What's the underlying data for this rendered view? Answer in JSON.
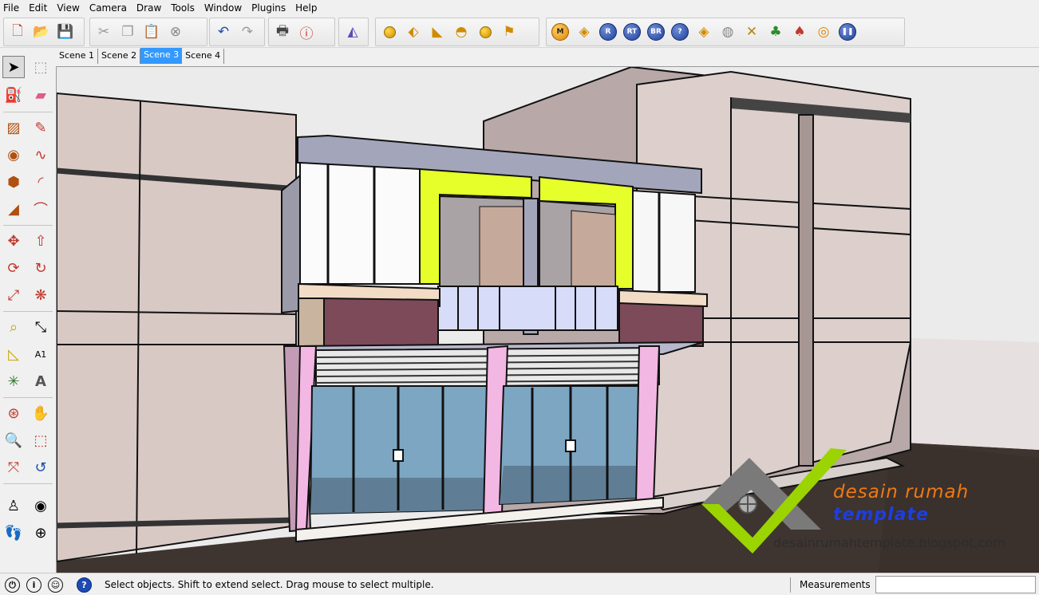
{
  "menu": [
    "File",
    "Edit",
    "View",
    "Camera",
    "Draw",
    "Tools",
    "Window",
    "Plugins",
    "Help"
  ],
  "scenes": [
    {
      "label": "Scene 1",
      "active": false
    },
    {
      "label": "Scene 2",
      "active": false
    },
    {
      "label": "Scene 3",
      "active": true
    },
    {
      "label": "Scene 4",
      "active": false
    }
  ],
  "toolbar": {
    "round_buttons": [
      "M",
      "R",
      "RT",
      "BR",
      "?"
    ]
  },
  "status": {
    "message": "Select objects. Shift to extend select. Drag mouse to select multiple.",
    "measurements_label": "Measurements",
    "measurements_value": ""
  },
  "watermark": {
    "title": "desain rumah",
    "subtitle": "template",
    "url": "desainrumahtemplate.blogspot.com"
  },
  "colors": {
    "selection": "#3399ff",
    "wall": "#ddd0c8",
    "accent_lime": "#e6ff2a",
    "balcony_panel": "#7d4a59",
    "pink_column": "#f3b7e4",
    "glass": "#7da6c2",
    "logo_green": "#9bd400",
    "logo_orange": "#f07a10",
    "logo_blue": "#1d3ee0"
  }
}
